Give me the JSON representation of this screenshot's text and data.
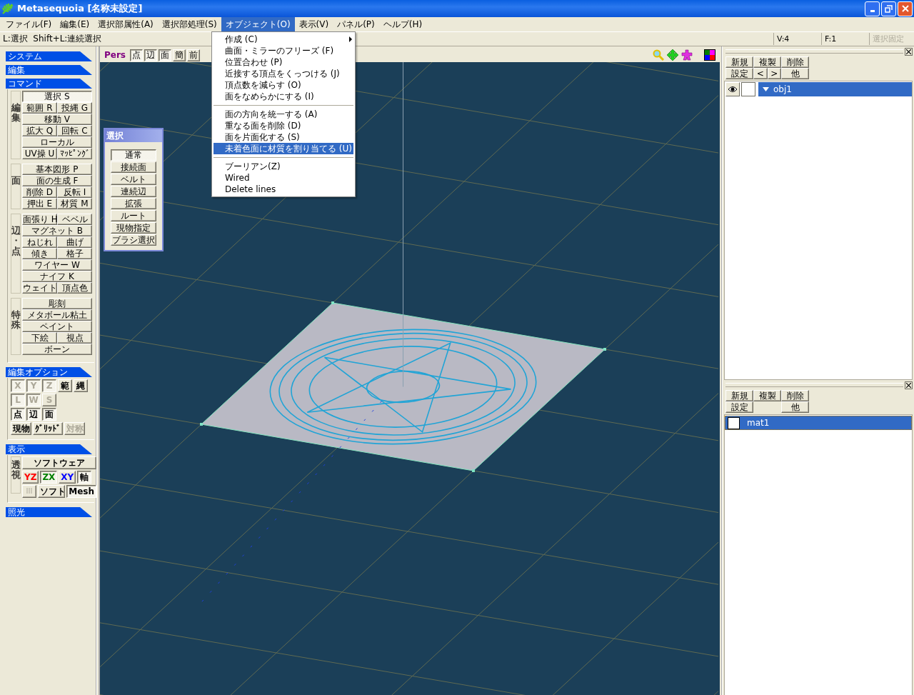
{
  "window": {
    "title": "Metasequoia [名称未設定]"
  },
  "menu_bar": [
    {
      "label": "ファイル(F)",
      "selected": false
    },
    {
      "label": "編集(E)",
      "selected": false
    },
    {
      "label": "選択部属性(A)",
      "selected": false
    },
    {
      "label": "選択部処理(S)",
      "selected": false
    },
    {
      "label": "オブジェクト(O)",
      "selected": true
    },
    {
      "label": "表示(V)",
      "selected": false
    },
    {
      "label": "パネル(P)",
      "selected": false
    },
    {
      "label": "ヘルプ(H)",
      "selected": false
    }
  ],
  "dropdown": [
    {
      "kind": "item",
      "label": "作成 (C)",
      "submenu": true,
      "selected": false
    },
    {
      "kind": "item",
      "label": "曲面・ミラーのフリーズ (F)",
      "submenu": false,
      "selected": false
    },
    {
      "kind": "item",
      "label": "位置合わせ (P)",
      "submenu": false,
      "selected": false
    },
    {
      "kind": "item",
      "label": "近接する頂点をくっつける (J)",
      "submenu": false,
      "selected": false
    },
    {
      "kind": "item",
      "label": "頂点数を減らす (O)",
      "submenu": false,
      "selected": false
    },
    {
      "kind": "item",
      "label": "面をなめらかにする (I)",
      "submenu": false,
      "selected": false
    },
    {
      "kind": "separator"
    },
    {
      "kind": "item",
      "label": "面の方向を統一する (A)",
      "submenu": false,
      "selected": false
    },
    {
      "kind": "item",
      "label": "重なる面を削除 (D)",
      "submenu": false,
      "selected": false
    },
    {
      "kind": "item",
      "label": "面を片面化する (S)",
      "submenu": false,
      "selected": false
    },
    {
      "kind": "item",
      "label": "未着色面に材質を割り当てる (U)",
      "submenu": false,
      "selected": true
    },
    {
      "kind": "separator"
    },
    {
      "kind": "item",
      "label": "ブーリアン(Z)",
      "submenu": false,
      "selected": false
    },
    {
      "kind": "item",
      "label": "Wired",
      "submenu": false,
      "selected": false
    },
    {
      "kind": "item",
      "label": "Delete lines",
      "submenu": false,
      "selected": false
    }
  ],
  "hint": "L:選択  Shift+L:連続選択",
  "status": [
    {
      "text": "V:4",
      "disabled": false
    },
    {
      "text": "F:1",
      "disabled": false
    },
    {
      "text": "選択固定",
      "disabled": true
    }
  ],
  "left_panel": {
    "sections": [
      {
        "title": "システム"
      },
      {
        "title": "編集"
      },
      {
        "title": "コマンド",
        "kind": "command",
        "groups": [
          {
            "label": "編集",
            "rows": [
              [
                {
                  "label": "選択 S",
                  "selected": true
                }
              ],
              [
                {
                  "label": "範囲 R",
                  "selected": false
                },
                {
                  "label": "投縄 G",
                  "selected": false
                }
              ],
              [
                {
                  "label": "移動 V",
                  "selected": false
                }
              ],
              [
                {
                  "label": "拡大 Q",
                  "selected": false
                },
                {
                  "label": "回転 C",
                  "selected": false
                }
              ],
              [
                {
                  "label": "ローカル",
                  "selected": false
                }
              ],
              [
                {
                  "label": "UV操 U",
                  "selected": false
                },
                {
                  "label": "ﾏｯﾋﾟﾝｸﾞ",
                  "selected": false
                }
              ]
            ]
          },
          {
            "label": "面",
            "rows": [
              [
                {
                  "label": "基本図形 P",
                  "selected": false
                }
              ],
              [
                {
                  "label": "面の生成 F",
                  "selected": false
                }
              ],
              [
                {
                  "label": "削除 D",
                  "selected": false
                },
                {
                  "label": "反転 I",
                  "selected": false
                }
              ],
              [
                {
                  "label": "押出 E",
                  "selected": false
                },
                {
                  "label": "材質 M",
                  "selected": false
                }
              ]
            ]
          },
          {
            "label": "辺・点",
            "rows": [
              [
                {
                  "label": "面張り H",
                  "selected": false
                },
                {
                  "label": "ベベル",
                  "selected": false
                }
              ],
              [
                {
                  "label": "マグネット B",
                  "selected": false
                }
              ],
              [
                {
                  "label": "ねじれ",
                  "selected": false
                },
                {
                  "label": "曲げ",
                  "selected": false
                }
              ],
              [
                {
                  "label": "傾き",
                  "selected": false
                },
                {
                  "label": "格子",
                  "selected": false
                }
              ],
              [
                {
                  "label": "ワイヤー W",
                  "selected": false
                }
              ],
              [
                {
                  "label": "ナイフ K",
                  "selected": false
                }
              ],
              [
                {
                  "label": "ウェイト",
                  "selected": false
                },
                {
                  "label": "頂点色",
                  "selected": false
                }
              ]
            ]
          },
          {
            "label": "特殊",
            "rows": [
              [
                {
                  "label": "彫刻",
                  "selected": false
                }
              ],
              [
                {
                  "label": "メタボール粘土",
                  "selected": false
                }
              ],
              [
                {
                  "label": "ペイント",
                  "selected": false
                }
              ],
              [
                {
                  "label": "下絵",
                  "selected": false
                },
                {
                  "label": "視点",
                  "selected": false
                }
              ],
              [
                {
                  "label": "ボーン",
                  "selected": false
                }
              ]
            ]
          }
        ]
      },
      {
        "title": "編集オプション",
        "kind": "option",
        "groups": [
          {
            "rows": [
              {
                "buttons": [
                  {
                    "label": "X",
                    "selected": true,
                    "disabled": true
                  },
                  {
                    "label": "Y",
                    "selected": true,
                    "disabled": true
                  },
                  {
                    "label": "Z",
                    "selected": true,
                    "disabled": true
                  },
                  {
                    "label": "範",
                    "selected": false,
                    "disabled": false
                  },
                  {
                    "label": "縄",
                    "selected": false,
                    "disabled": false
                  }
                ]
              },
              {
                "buttons": [
                  {
                    "label": "L",
                    "selected": true,
                    "disabled": true
                  },
                  {
                    "label": "W",
                    "selected": true,
                    "disabled": true
                  },
                  {
                    "label": "S",
                    "selected": false,
                    "disabled": true
                  }
                ]
              },
              {
                "buttons": [
                  {
                    "label": "点",
                    "selected": true,
                    "disabled": false
                  },
                  {
                    "label": "辺",
                    "selected": true,
                    "disabled": false
                  },
                  {
                    "label": "面",
                    "selected": true,
                    "disabled": false
                  }
                ]
              },
              {
                "buttons": [
                  {
                    "label": "現物",
                    "selected": false,
                    "disabled": false
                  },
                  {
                    "label": "ｸﾞﾘｯﾄﾞ",
                    "selected": false,
                    "disabled": false
                  },
                  {
                    "label": "対称",
                    "selected": false,
                    "disabled": true
                  }
                ]
              }
            ]
          }
        ]
      },
      {
        "title": "表示",
        "kind": "option",
        "groups": [
          {
            "label": "透視",
            "rows": [
              {
                "buttons": [
                  {
                    "label": "ソフトウェア",
                    "selected": false,
                    "disabled": false,
                    "kind": "wide"
                  }
                ]
              },
              {
                "buttons": [
                  {
                    "label": "YZ",
                    "selected": false,
                    "disabled": false,
                    "color": "#ff0000"
                  },
                  {
                    "label": "ZX",
                    "selected": true,
                    "disabled": false,
                    "color": "#008000"
                  },
                  {
                    "label": "XY",
                    "selected": false,
                    "disabled": false,
                    "color": "#0000ff"
                  },
                  {
                    "label": "軸",
                    "selected": true,
                    "disabled": false
                  }
                ]
              },
              {
                "buttons": [
                  {
                    "kind": "icon",
                    "selected": false,
                    "disabled": true
                  },
                  {
                    "label": "ソフト",
                    "selected": false,
                    "disabled": false,
                    "kind": "wide"
                  },
                  {
                    "label": "Mesh",
                    "selected": true,
                    "disabled": false
                  }
                ]
              }
            ]
          }
        ]
      },
      {
        "title": "照光"
      }
    ]
  },
  "view": {
    "mode": "Pers",
    "buttons": [
      {
        "label": "点",
        "selected": true
      },
      {
        "label": "辺",
        "selected": true
      },
      {
        "label": "面",
        "selected": true
      },
      {
        "label": "簡",
        "selected": false
      },
      {
        "label": "前",
        "selected": false
      }
    ]
  },
  "palette": {
    "title": "選択",
    "buttons": [
      {
        "label": "通常",
        "selected": true
      },
      {
        "label": "接続面",
        "selected": false
      },
      {
        "label": "ベルト",
        "selected": false
      },
      {
        "label": "連続辺",
        "selected": false
      },
      {
        "label": "拡張",
        "selected": false
      },
      {
        "label": "ルート",
        "selected": false
      },
      {
        "label": "現物指定",
        "selected": false
      },
      {
        "label": "ブラシ選択",
        "selected": false
      }
    ]
  },
  "object_panel": {
    "buttons": [
      [
        {
          "label": "新規",
          "kind": "wide"
        },
        {
          "label": "複製",
          "kind": "wide"
        },
        {
          "label": "削除",
          "kind": "wide"
        }
      ],
      [
        {
          "label": "設定",
          "kind": "wide"
        },
        {
          "label": "<",
          "kind": "narrow"
        },
        {
          "label": ">",
          "kind": "narrow"
        },
        {
          "label": "他",
          "kind": "wide"
        }
      ]
    ],
    "objects": [
      {
        "name": "obj1",
        "selected": true,
        "visible": true,
        "expanded": true
      }
    ]
  },
  "material_panel": {
    "buttons": [
      [
        {
          "label": "新規",
          "kind": "wide"
        },
        {
          "label": "複製",
          "kind": "wide"
        },
        {
          "label": "削除",
          "kind": "wide"
        }
      ],
      [
        {
          "label": "設定",
          "kind": "wide"
        },
        {
          "label": "他",
          "kind": "wide"
        }
      ]
    ],
    "materials": [
      {
        "name": "mat1",
        "selected": true,
        "color": "#ffffff"
      }
    ]
  }
}
